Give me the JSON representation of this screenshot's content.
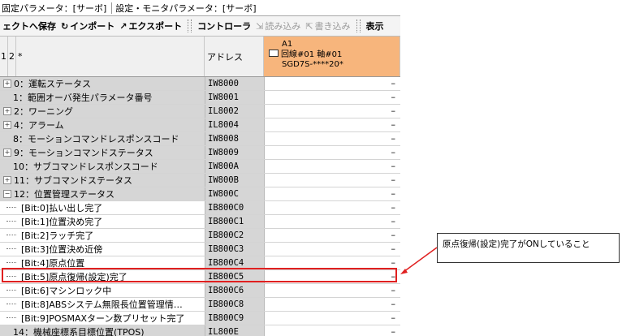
{
  "tabs": [
    "固定パラメータ：[サーボ]",
    "設定・モニタパラメータ：[サーボ]"
  ],
  "toolbar": {
    "items": [
      {
        "label": "ェクトへ保存",
        "icon": "save-icon"
      },
      {
        "label": "インポート",
        "icon": "import-icon"
      },
      {
        "label": "エクスポート",
        "icon": "export-icon"
      },
      {
        "label": "コントローラ",
        "icon": ""
      },
      {
        "label": "読み込み",
        "icon": "read-icon"
      },
      {
        "label": "書き込み",
        "icon": "write-icon"
      },
      {
        "label": "表示",
        "icon": ""
      }
    ]
  },
  "grid": {
    "header": {
      "col1": "1",
      "col2": "2",
      "col3": "*",
      "address": "アドレス",
      "axis": {
        "line1": "A1",
        "line2": "回線#01 軸#01",
        "line3": "SGD7S-****20*"
      }
    },
    "rows": [
      {
        "label": "0：運転ステータス",
        "address": "IW8000",
        "value": "–",
        "expand": "+"
      },
      {
        "label": "1：範囲オーバ発生パラメータ番号",
        "address": "IW8001",
        "value": "–",
        "expand": ""
      },
      {
        "label": "2：ワーニング",
        "address": "IL8002",
        "value": "–",
        "expand": "+"
      },
      {
        "label": "4：アラーム",
        "address": "IL8004",
        "value": "–",
        "expand": "+"
      },
      {
        "label": "8：モーションコマンドレスポンスコード",
        "address": "IW8008",
        "value": "–",
        "expand": ""
      },
      {
        "label": "9：モーションコマンドステータス",
        "address": "IW8009",
        "value": "–",
        "expand": "+"
      },
      {
        "label": "10：サブコマンドレスポンスコード",
        "address": "IW800A",
        "value": "–",
        "expand": ""
      },
      {
        "label": "11：サブコマンドステータス",
        "address": "IW800B",
        "value": "–",
        "expand": "+"
      },
      {
        "label": "12：位置管理ステータス",
        "address": "IW800C",
        "value": "–",
        "expand": "–"
      },
      {
        "label": "[Bit:0]払い出し完了",
        "address": "IB800C0",
        "value": "–",
        "expand": "leaf"
      },
      {
        "label": "[Bit:1]位置決め完了",
        "address": "IB800C1",
        "value": "–",
        "expand": "leaf"
      },
      {
        "label": "[Bit:2]ラッチ完了",
        "address": "IB800C2",
        "value": "–",
        "expand": "leaf"
      },
      {
        "label": "[Bit:3]位置決め近傍",
        "address": "IB800C3",
        "value": "–",
        "expand": "leaf"
      },
      {
        "label": "[Bit:4]原点位置",
        "address": "IB800C4",
        "value": "–",
        "expand": "leaf"
      },
      {
        "label": "[Bit:5]原点復帰(設定)完了",
        "address": "IB800C5",
        "value": "–",
        "expand": "leaf"
      },
      {
        "label": "[Bit:6]マシンロック中",
        "address": "IB800C6",
        "value": "–",
        "expand": "leaf"
      },
      {
        "label": "[Bit:8]ABSシステム無限長位置管理情…",
        "address": "IB800C8",
        "value": "–",
        "expand": "leaf"
      },
      {
        "label": "[Bit:9]POSMAXターン数プリセット完了",
        "address": "IB800C9",
        "value": "–",
        "expand": "leaf"
      },
      {
        "label": "14：機械座標系目標位置(TPOS)",
        "address": "IL800E",
        "value": "–",
        "expand": ""
      }
    ]
  },
  "callout": {
    "text": "原点復帰(設定)完了がONしていること"
  },
  "colors": {
    "highlight": "#e02020",
    "axis_header": "#f7b57c"
  }
}
